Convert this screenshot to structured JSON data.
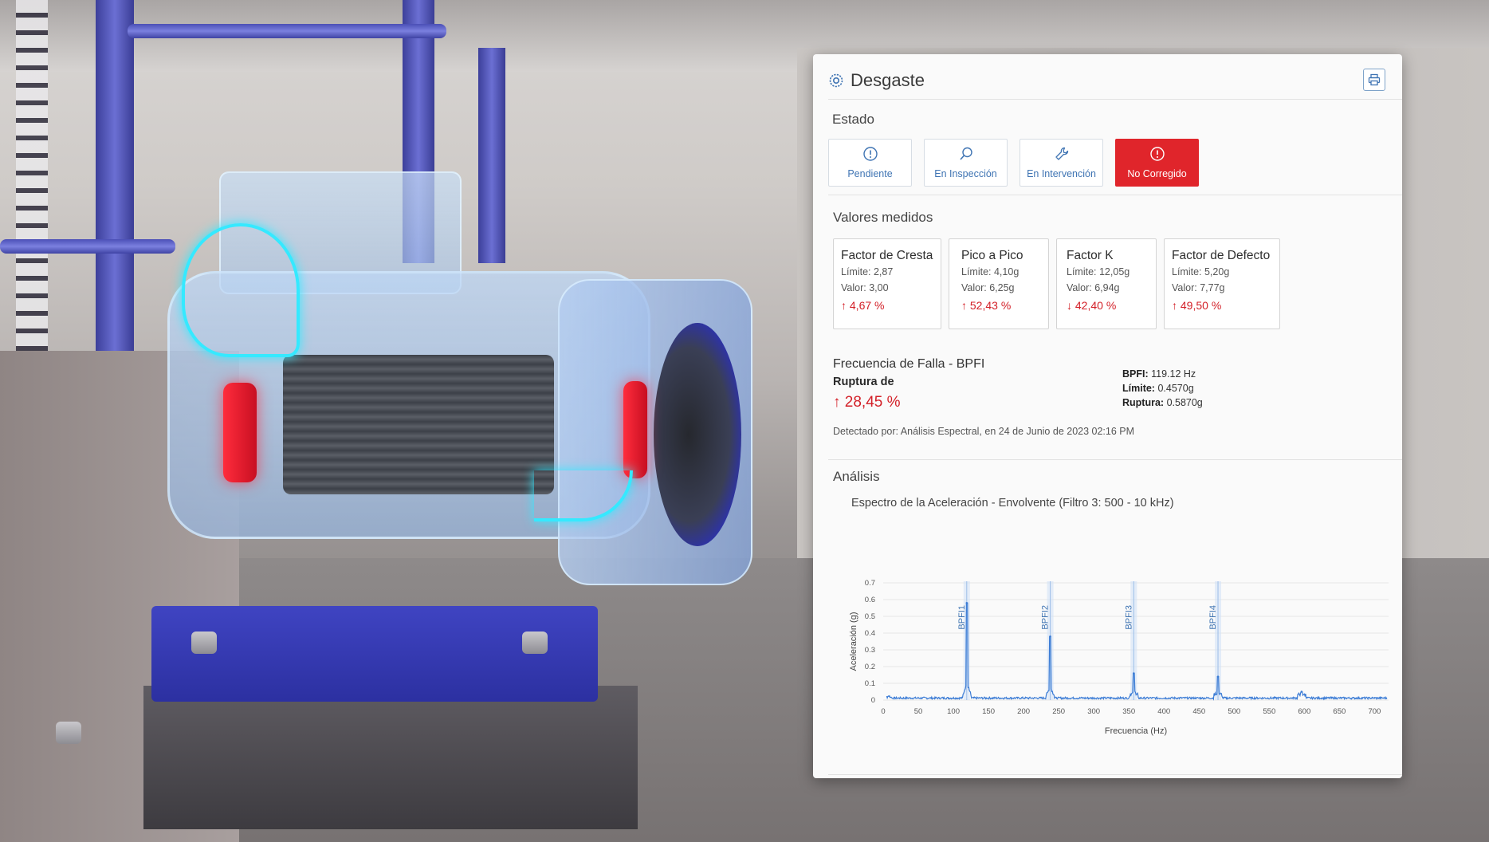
{
  "panel": {
    "title": "Desgaste",
    "estado_label": "Estado",
    "states": [
      {
        "label": "Pendiente",
        "icon": "alert-circle-icon",
        "active": false
      },
      {
        "label": "En Inspección",
        "icon": "search-icon",
        "active": false
      },
      {
        "label": "En Intervención",
        "icon": "wrench-icon",
        "active": false
      },
      {
        "label": "No Corregido",
        "icon": "alert-circle-icon",
        "active": true
      }
    ],
    "valores_label": "Valores medidos",
    "metrics": [
      {
        "title": "Factor de Cresta",
        "limit": "Límite: 2,87",
        "value": "Valor: 3,00",
        "pct": "↑ 4,67 %"
      },
      {
        "title": "Pico a Pico",
        "limit": "Límite: 4,10g",
        "value": "Valor: 6,25g",
        "pct": "↑ 52,43 %"
      },
      {
        "title": "Factor K",
        "limit": "Límite: 12,05g",
        "value": "Valor: 6,94g",
        "pct": "↓ 42,40 %"
      },
      {
        "title": "Factor de Defecto",
        "limit": "Límite: 5,20g",
        "value": "Valor: 7,77g",
        "pct": "↑ 49,50 %"
      }
    ],
    "failure": {
      "title": "Frecuencia de Falla - BPFI",
      "rupture_label": "Ruptura de",
      "rupture_value": "↑ 28,45 %",
      "bpfi_key": "BPFI:",
      "bpfi_val": "119.12 Hz",
      "limit_key": "Límite:",
      "limit_val": "0.4570g",
      "rupture_key": "Ruptura:",
      "rupture_val": "0.5870g",
      "detected": "Detectado por: Análisis Espectral, en 24 de Junio de 2023 02:16 PM"
    },
    "analisis_label": "Análisis",
    "accent": "#3f74b3",
    "alert": "#e0252b"
  },
  "chart_data": {
    "type": "line",
    "title": "Espectro de la Aceleración - Envolvente (Filtro 3: 500 - 10 kHz)",
    "xlabel": "Frecuencia (Hz)",
    "ylabel": "Aceleración (g)",
    "xlim": [
      0,
      720
    ],
    "ylim": [
      0,
      0.7
    ],
    "xticks": [
      0,
      50,
      100,
      150,
      200,
      250,
      300,
      350,
      400,
      450,
      500,
      550,
      600,
      650,
      700
    ],
    "yticks": [
      0,
      0.1,
      0.2,
      0.3,
      0.4,
      0.5,
      0.6,
      0.7
    ],
    "ytick_labels": [
      "0",
      "0.1",
      "0.2",
      "0.3",
      "0.4",
      "0.5",
      "0.6",
      "0.7"
    ],
    "markers": [
      {
        "label": "BPFI1",
        "x": 119
      },
      {
        "label": "BPFI2",
        "x": 238
      },
      {
        "label": "BPFI3",
        "x": 357
      },
      {
        "label": "BPFI4",
        "x": 477
      }
    ],
    "peaks": [
      {
        "x": 119,
        "y": 0.58
      },
      {
        "x": 238,
        "y": 0.38
      },
      {
        "x": 357,
        "y": 0.16
      },
      {
        "x": 477,
        "y": 0.14
      },
      {
        "x": 596,
        "y": 0.05
      }
    ],
    "color": "#3a7bd5"
  }
}
